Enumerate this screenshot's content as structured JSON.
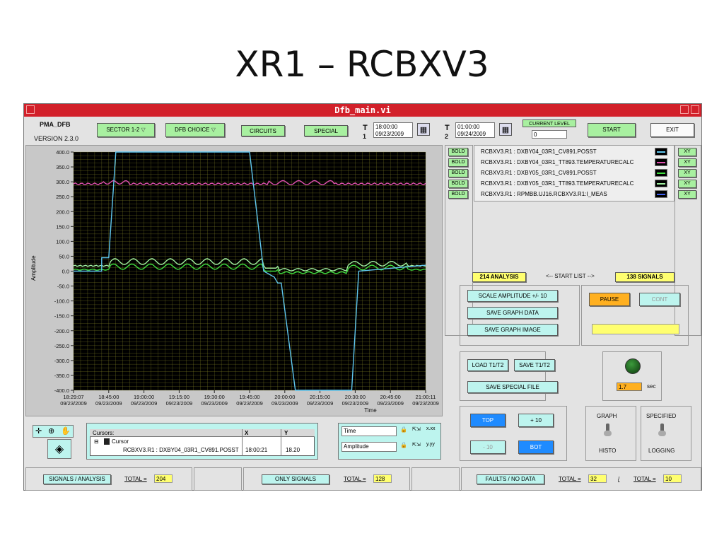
{
  "slide": {
    "title": "XR1 – RCBXV3"
  },
  "window": {
    "title": "Dfb_main.vi"
  },
  "toolbar": {
    "app_name": "PMA_DFB",
    "version": "VERSION 2.3.0",
    "sector_label": "SECTOR 1-2",
    "dfb_choice_label": "DFB CHOICE",
    "circuits_label": "CIRCUITS",
    "special_label": "SPECIAL",
    "t1_label": "T",
    "t1_index": "1",
    "t1_time": "18:00:00",
    "t1_date": "09/23/2009",
    "t2_label": "T",
    "t2_index": "2",
    "t2_time": "01:00:00",
    "t2_date": "09/24/2009",
    "current_level_label": "CURRENT LEVEL",
    "current_level_value": "0",
    "start_label": "START",
    "exit_label": "EXIT"
  },
  "plot": {
    "ylabel": "Amplitude",
    "xlabel": "Time",
    "ylim": [
      -400,
      400
    ],
    "y_ticks": [
      "400.0",
      "350.0",
      "300.0",
      "250.0",
      "200.0",
      "150.0",
      "100.0",
      "50.0",
      "0.0",
      "-50.0",
      "-100.0",
      "-150.0",
      "-200.0",
      "-250.0",
      "-300.0",
      "-350.0",
      "-400.0"
    ],
    "x_ticks": [
      {
        "time": "18:29:07",
        "date": "09/23/2009"
      },
      {
        "time": "18:45:00",
        "date": "09/23/2009"
      },
      {
        "time": "19:00:00",
        "date": "09/23/2009"
      },
      {
        "time": "19:15:00",
        "date": "09/23/2009"
      },
      {
        "time": "19:30:00",
        "date": "09/23/2009"
      },
      {
        "time": "19:45:00",
        "date": "09/23/2009"
      },
      {
        "time": "20:00:00",
        "date": "09/23/2009"
      },
      {
        "time": "20:15:00",
        "date": "09/23/2009"
      },
      {
        "time": "20:30:00",
        "date": "09/23/2009"
      },
      {
        "time": "20:45:00",
        "date": "09/23/2009"
      },
      {
        "time": "21:00:11",
        "date": "09/23/2009"
      }
    ],
    "colors": {
      "background": "#000000",
      "grid": "#8a8a2a",
      "pink": "#e050b0",
      "cyan": "#60c8f0",
      "green": "#40e040",
      "green2": "#a0f0a0"
    }
  },
  "legend": {
    "bold_label": "BOLD",
    "xy_label": "XY",
    "signals": [
      "RCBXV3.R1 : DXBY04_03R1_CV891.POSST",
      "RCBXV3.R1 : DXBY04_03R1_TT893.TEMPERATURECALC",
      "RCBXV3.R1 : DXBY05_03R1_CV891.POSST",
      "RCBXV3.R1 : DXBY05_03R1_TT893.TEMPERATURECALC",
      "RCBXV3.R1 : RPMBB.UJ16.RCBXV3.R1:I_MEAS"
    ],
    "signal_colors": [
      "#60c8f0",
      "#e050b0",
      "#40e040",
      "#a0f0a0",
      "#4060f0"
    ]
  },
  "start_list": {
    "analysis": "214 ANALYSIS",
    "arrow_label": "<-- START LIST -->",
    "signals": "138 SIGNALS"
  },
  "controls": {
    "scale_amplitude": "SCALE AMPLITUDE +/- 10",
    "save_graph_data": "SAVE GRAPH DATA",
    "save_graph_image": "SAVE GRAPH IMAGE",
    "pause": "PAUSE",
    "cont": "CONT",
    "load_t1t2": "LOAD T1/T2",
    "save_t1t2": "SAVE T1/T2",
    "save_special_file": "SAVE SPECIAL FILE",
    "delay_value": "1.7",
    "delay_unit": "sec",
    "top": "TOP",
    "plus10": "+ 10",
    "minus10": "- 10",
    "bot": "BOT",
    "graph_label": "GRAPH",
    "histo_label": "HISTO",
    "specified_label": "SPECIFIED",
    "logging_label": "LOGGING"
  },
  "cursors": {
    "header": "Cursors:",
    "col_x": "X",
    "col_y": "Y",
    "cursor_name": "Cursor",
    "cursor_signal": "RCBXV3.R1 : DXBY04_03R1_CV891.POSST",
    "cursor_x": "18:00:21",
    "cursor_y": "18.20"
  },
  "scale_legend": {
    "time_label": "Time",
    "amplitude_label": "Amplitude"
  },
  "footer": {
    "signals_analysis": "SIGNALS / ANALYSIS",
    "total_label": "TOTAL =",
    "total1": "204",
    "only_signals": "ONLY SIGNALS",
    "total2": "128",
    "faults_no_data": "FAULTS / NO DATA",
    "total3": "32",
    "slash": "/",
    "total4": "10"
  }
}
